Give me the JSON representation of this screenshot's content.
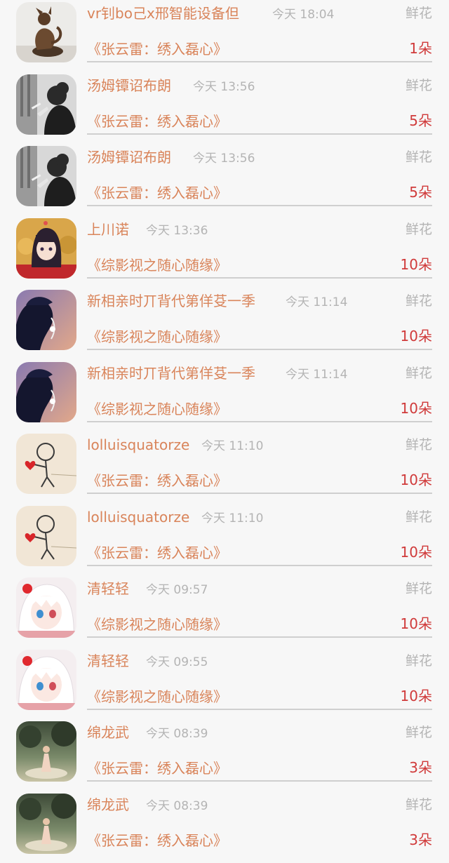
{
  "records": [
    {
      "name": "vr钊bo己x邢智能设备但",
      "time": "今天 18:04",
      "gift": "鲜花",
      "book": "《张云雷：绣入磊心》",
      "count": "1朵",
      "avatar": "sculpture-avatar"
    },
    {
      "name": "汤姆镡诏布朗",
      "time": "今天 13:56",
      "gift": "鲜花",
      "book": "《张云雷：绣入磊心》",
      "count": "5朵",
      "avatar": "smoking-woman-avatar"
    },
    {
      "name": "汤姆镡诏布朗",
      "time": "今天 13:56",
      "gift": "鲜花",
      "book": "《张云雷：绣入磊心》",
      "count": "5朵",
      "avatar": "smoking-woman-avatar"
    },
    {
      "name": "上川诺",
      "time": "今天 13:36",
      "gift": "鲜花",
      "book": "《综影视之随心随缘》",
      "count": "10朵",
      "avatar": "anime-girl-avatar"
    },
    {
      "name": "新相亲时丌背代第佯芟一季",
      "time": "今天 11:14",
      "gift": "鲜花",
      "book": "《综影视之随心随缘》",
      "count": "10朵",
      "avatar": "boy-silhouette-avatar"
    },
    {
      "name": "新相亲时丌背代第佯芟一季",
      "time": "今天 11:14",
      "gift": "鲜花",
      "book": "《综影视之随心随缘》",
      "count": "10朵",
      "avatar": "boy-silhouette-avatar"
    },
    {
      "name": "lolluisquatorze",
      "time": "今天 11:10",
      "gift": "鲜花",
      "book": "《张云雷：绣入磊心》",
      "count": "10朵",
      "avatar": "doodle-heart-avatar"
    },
    {
      "name": "lolluisquatorze",
      "time": "今天 11:10",
      "gift": "鲜花",
      "book": "《张云雷：绣入磊心》",
      "count": "10朵",
      "avatar": "doodle-heart-avatar"
    },
    {
      "name": "清轻轻",
      "time": "今天 09:57",
      "gift": "鲜花",
      "book": "《综影视之随心随缘》",
      "count": "10朵",
      "avatar": "white-hair-anime-avatar"
    },
    {
      "name": "清轻轻",
      "time": "今天 09:55",
      "gift": "鲜花",
      "book": "《综影视之随心随缘》",
      "count": "10朵",
      "avatar": "white-hair-anime-avatar"
    },
    {
      "name": "绵龙武",
      "time": "今天 08:39",
      "gift": "鲜花",
      "book": "《张云雷：绣入磊心》",
      "count": "3朵",
      "avatar": "forest-girl-avatar"
    },
    {
      "name": "绵龙武",
      "time": "今天 08:39",
      "gift": "鲜花",
      "book": "《张云雷：绣入磊心》",
      "count": "3朵",
      "avatar": "forest-girl-avatar"
    }
  ],
  "colors": {
    "name": "#d9845a",
    "time": "#b4b4b4",
    "count": "#d03a3a",
    "background": "#f7f7f7"
  }
}
